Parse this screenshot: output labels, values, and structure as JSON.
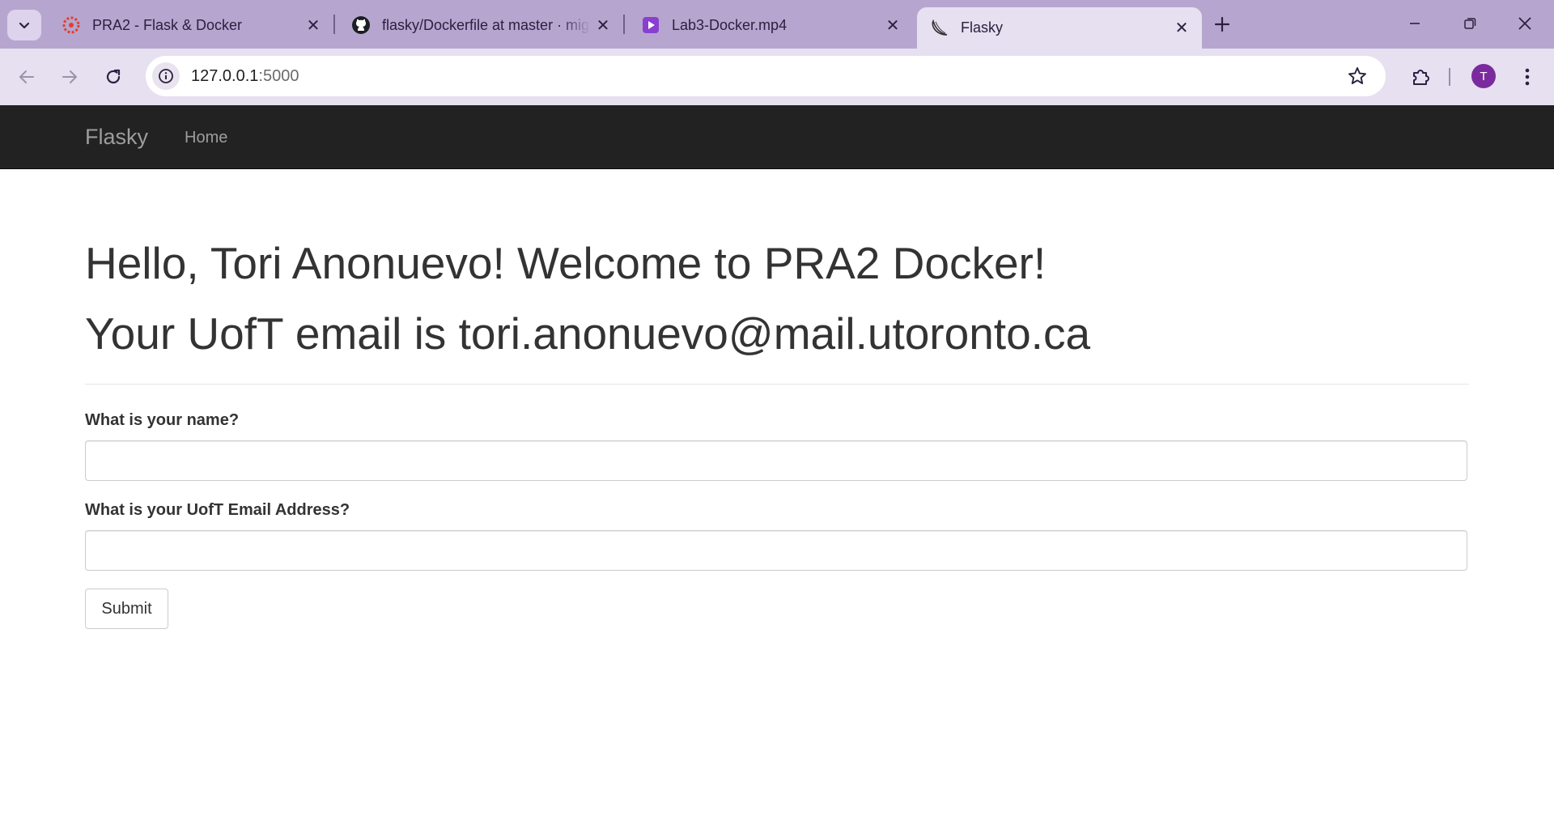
{
  "browser": {
    "tabs": [
      {
        "title": "PRA2 - Flask & Docker",
        "favicon": "canvas-logo-icon",
        "active": false
      },
      {
        "title": "flasky/Dockerfile at master · miguelgrinberg",
        "favicon": "github-icon",
        "active": false
      },
      {
        "title": "Lab3-Docker.mp4",
        "favicon": "video-play-icon",
        "active": false
      },
      {
        "title": "Flasky",
        "favicon": "flask-icon",
        "active": true
      }
    ],
    "address": {
      "host": "127.0.0.1",
      "port": ":5000"
    },
    "profile_initial": "T",
    "accent_colors": {
      "tabstrip": "#b6a6cf",
      "toolbar": "#e6e0f0",
      "avatar": "#7b2a9e"
    }
  },
  "navbar": {
    "brand": "Flasky",
    "home": "Home"
  },
  "main": {
    "greeting": "Hello, Tori Anonuevo! Welcome to PRA2 Docker!",
    "email_line": "Your UofT email is tori.anonuevo@mail.utoronto.ca",
    "form": {
      "name_label": "What is your name?",
      "name_value": "",
      "email_label": "What is your UofT Email Address?",
      "email_value": "",
      "submit_label": "Submit"
    }
  }
}
